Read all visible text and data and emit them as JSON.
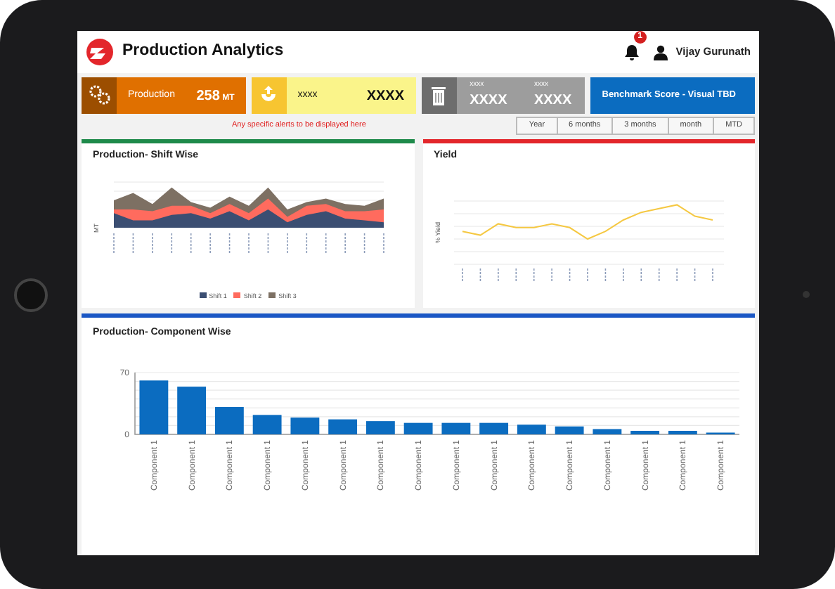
{
  "header": {
    "title": "Production Analytics",
    "notification_count": "1",
    "user_name": "Vijay Gurunath"
  },
  "kpi_tiles": [
    {
      "kind": "single",
      "label": "Production",
      "value": "258",
      "unit": "MT",
      "color": "#e07000"
    },
    {
      "kind": "single",
      "label": "xxxx",
      "value": "XXXX",
      "color": "#faf48a"
    },
    {
      "kind": "double",
      "pairs": [
        {
          "label": "xxxx",
          "value": "XXXX"
        },
        {
          "label": "xxxx",
          "value": "XXXX"
        }
      ],
      "color": "#9d9d9d"
    },
    {
      "kind": "text",
      "label": "Benchmark Score - Visual TBD",
      "color": "#0b6cc0"
    }
  ],
  "alert": "Any specific alerts to be displayed here",
  "period_buttons": [
    "Year",
    "6 months",
    "3 months",
    "month",
    "MTD"
  ],
  "panels": [
    {
      "kind": "area",
      "title": "Production- Shift Wise",
      "color": "#1e8a4a",
      "ylabel": "MT",
      "legend": [
        {
          "label": "Shift 1",
          "color": "#3b4e72"
        },
        {
          "label": "Shift 2",
          "color": "#ff6b5e"
        },
        {
          "label": "Shift 3",
          "color": "#7d7063"
        }
      ]
    },
    {
      "kind": "line",
      "title": "Yield",
      "color": "#e3262b",
      "ylabel": "% Yield"
    }
  ],
  "component_panel": {
    "title": "Production- Component Wise",
    "color": "#1a56c4",
    "chart_data": {
      "type": "bar",
      "categories": [
        "Component 1",
        "Component 1",
        "Component 1",
        "Component 1",
        "Component 1",
        "Component 1",
        "Component 1",
        "Component 1",
        "Component 1",
        "Component 1",
        "Component 1",
        "Component 1",
        "Component 1",
        "Component 1",
        "Component 1",
        "Component 1"
      ],
      "values": [
        61,
        54,
        31,
        22,
        19,
        17,
        15,
        13,
        13,
        13,
        11,
        9,
        6,
        4,
        4,
        2
      ],
      "ylim": [
        0,
        70
      ],
      "yticks": [
        0,
        70
      ]
    }
  }
}
